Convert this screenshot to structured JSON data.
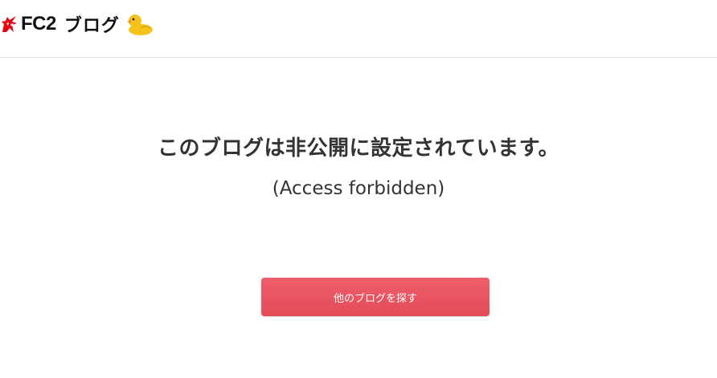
{
  "header": {
    "brand": "FC2",
    "product": "ブログ",
    "logo_icon": "fc2-unicorn-icon",
    "mascot_icon": "duck-icon"
  },
  "main": {
    "message": "このブログは非公開に設定されています。",
    "sub_message": "(Access forbidden)",
    "button_label": "他のブログを探す"
  },
  "colors": {
    "button": "#e8515e",
    "logo_red": "#e60012",
    "duck_yellow": "#f6c31c"
  }
}
